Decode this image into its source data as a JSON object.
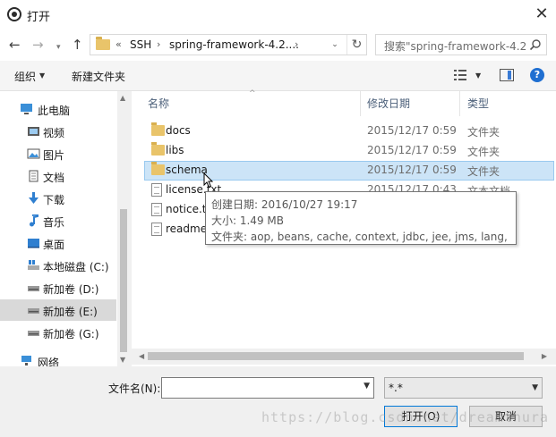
{
  "window": {
    "title": "打开",
    "close_label": "✕"
  },
  "nav": {
    "back_icon": "←",
    "forward_icon": "→",
    "recent_icon": "▾",
    "up_icon": "↑",
    "breadcrumb": [
      "«",
      "SSH",
      "›",
      "spring-framework-4.2....",
      "›"
    ],
    "refresh_icon": "↻",
    "dropdown_icon": "⌄"
  },
  "search": {
    "placeholder": "搜索\"spring-framework-4.2...",
    "icon": "search-icon"
  },
  "toolbar": {
    "organize_label": "组织",
    "organize_arrow": "▼",
    "new_folder_label": "新建文件夹",
    "view_arrow": "▼",
    "help_label": "?"
  },
  "sidebar": {
    "items": [
      {
        "label": "此电脑",
        "icon": "computer-icon",
        "selected": false
      },
      {
        "label": "视频",
        "icon": "video-icon",
        "selected": false
      },
      {
        "label": "图片",
        "icon": "pictures-icon",
        "selected": false
      },
      {
        "label": "文档",
        "icon": "documents-icon",
        "selected": false
      },
      {
        "label": "下载",
        "icon": "download-icon",
        "selected": false
      },
      {
        "label": "音乐",
        "icon": "music-icon",
        "selected": false
      },
      {
        "label": "桌面",
        "icon": "desktop-icon",
        "selected": false
      },
      {
        "label": "本地磁盘 (C:)",
        "icon": "windows-drive-icon",
        "selected": false
      },
      {
        "label": "新加卷 (D:)",
        "icon": "drive-icon",
        "selected": false
      },
      {
        "label": "新加卷 (E:)",
        "icon": "drive-icon",
        "selected": true
      },
      {
        "label": "新加卷 (G:)",
        "icon": "drive-icon",
        "selected": false
      },
      {
        "label": "网络",
        "icon": "network-icon",
        "selected": false
      }
    ]
  },
  "files": {
    "columns": {
      "name": "名称",
      "date": "修改日期",
      "type": "类型"
    },
    "rows": [
      {
        "name": "docs",
        "date": "2015/12/17 0:59",
        "type": "文件夹",
        "kind": "folder",
        "selected": false
      },
      {
        "name": "libs",
        "date": "2015/12/17 0:59",
        "type": "文件夹",
        "kind": "folder",
        "selected": false
      },
      {
        "name": "schema",
        "date": "2015/12/17 0:59",
        "type": "文件夹",
        "kind": "folder",
        "selected": true
      },
      {
        "name": "license.txt",
        "date": "2015/12/17 0:43",
        "type": "文本文档",
        "kind": "document",
        "selected": false
      },
      {
        "name": "notice.txt",
        "date": "",
        "type": "",
        "kind": "document",
        "selected": false
      },
      {
        "name": "readme.",
        "date": "",
        "type": "",
        "kind": "document",
        "selected": false
      }
    ]
  },
  "tooltip": {
    "created": "创建日期: 2016/10/27 19:17",
    "size": "大小: 1.49 MB",
    "contents": "文件夹: aop, beans, cache, context, jdbc, jee, jms, lang, mvc, ..."
  },
  "bottom": {
    "filename_label": "文件名(N):",
    "filename_value": "",
    "filter_value": "*.*",
    "open_label": "打开(O)",
    "cancel_label": "取消"
  },
  "watermark": "https://blog.csdn.net/dreamthura",
  "colors": {
    "accent": "#0078d7",
    "selection": "#cce4f7",
    "folder": "#e9c46a"
  }
}
